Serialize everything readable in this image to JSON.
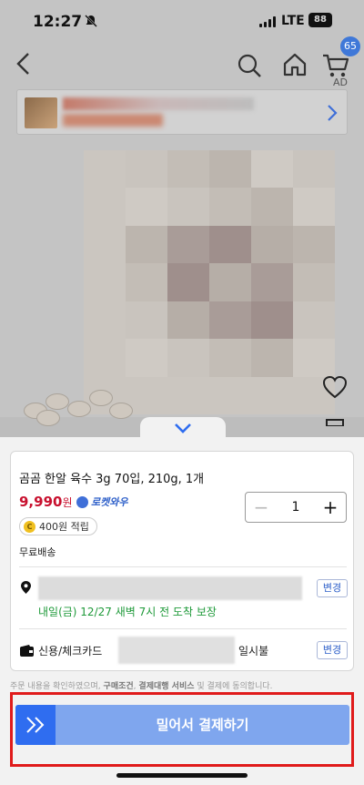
{
  "status_bar": {
    "time": "12:27",
    "network": "LTE",
    "battery": "88"
  },
  "nav": {
    "cart_count": "65",
    "ad_label": "AD"
  },
  "product": {
    "title": "곰곰 한알 육수 3g 70입, 210g, 1개",
    "price": "9,990",
    "price_unit": "원",
    "rocket_label": "로켓와우",
    "points": "400원 적립",
    "shipping": "무료배송",
    "quantity": "1"
  },
  "delivery": {
    "change_label": "변경",
    "guarantee": "내일(금) 12/27 새벽 7시 전 도착 보장"
  },
  "payment": {
    "method": "신용/체크카드",
    "installment": "일시불",
    "change_label": "변경"
  },
  "terms": {
    "prefix": "주문 내용을 확인하였으며,",
    "link1": "구매조건",
    "sep": ",",
    "link2": "결제대행 서비스",
    "suffix": "및 결제에 동의합니다."
  },
  "pay_button": {
    "label": "밀어서 결제하기"
  },
  "colors": {
    "accent": "#2f6df0",
    "price_red": "#c8102e",
    "delivery_green": "#1f9a3a",
    "highlight": "#e01b1b"
  }
}
